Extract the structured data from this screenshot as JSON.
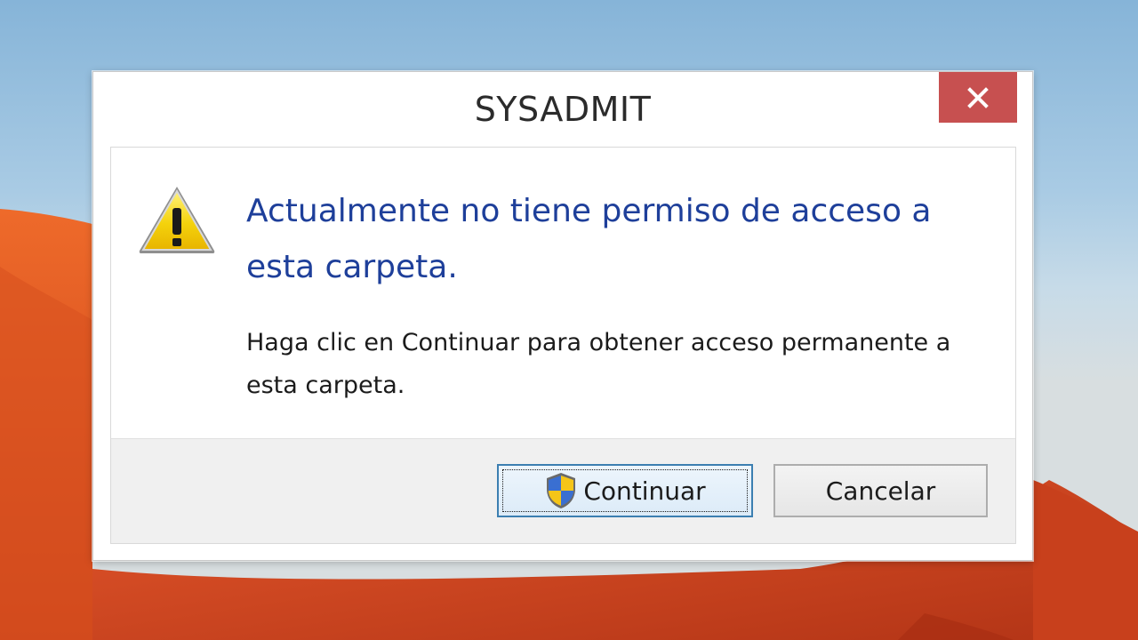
{
  "dialog": {
    "title": "SYSADMIT",
    "headline": "Actualmente no tiene permiso de acceso a esta carpeta.",
    "body": "Haga clic en Continuar para obtener acceso permanente a esta carpeta.",
    "icon": "warning-icon"
  },
  "buttons": {
    "continue_label": "Continuar",
    "continue_icon": "uac-shield-icon",
    "cancel_label": "Cancelar",
    "close_icon": "close-icon"
  },
  "colors": {
    "headline": "#1e3f9a",
    "close_button": "#c75050",
    "focus_border": "#3c7fb1"
  }
}
